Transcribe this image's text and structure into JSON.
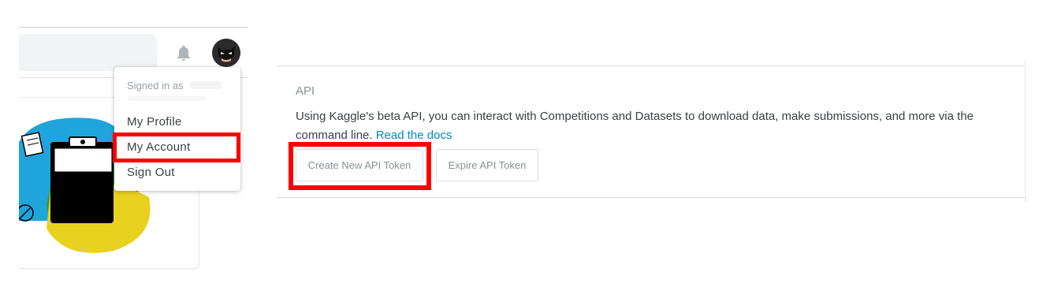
{
  "header": {
    "notifications_icon": "bell-icon",
    "avatar_icon": "avatar-icon"
  },
  "account_menu": {
    "signed_in_as": "Signed in as",
    "items": [
      {
        "label": "My Profile"
      },
      {
        "label": "My Account"
      },
      {
        "label": "Sign Out"
      }
    ]
  },
  "api_section": {
    "title": "API",
    "description": "Using Kaggle's beta API, you can interact with Competitions and Datasets to download data, make submissions, and more via the command line.",
    "docs_link": "Read the docs",
    "create_token_button": "Create New API Token",
    "expire_token_button": "Expire API Token"
  },
  "annotations": {
    "highlight_color": "#ff0000"
  }
}
